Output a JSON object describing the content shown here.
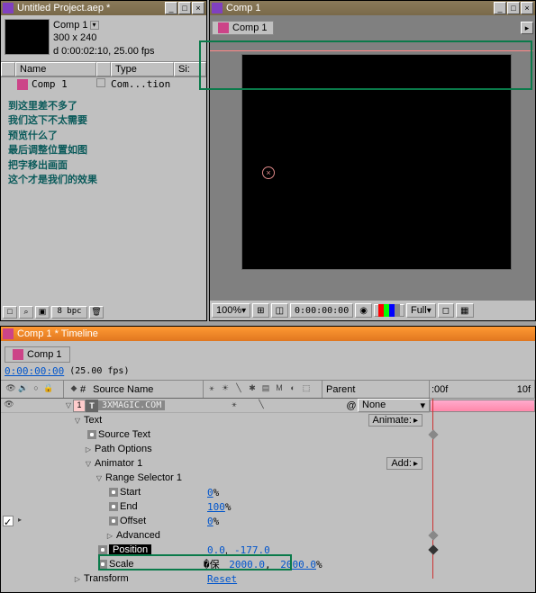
{
  "project": {
    "title": "Untitled Project.aep *",
    "comp_name": "Comp 1",
    "dims": "300 x 240",
    "duration": "d 0:00:02:10, 25.00 fps",
    "col_name": "Name",
    "col_type": "Type",
    "col_size": "Si:",
    "item_name": "Comp 1",
    "item_type": "Com...tion",
    "bpc": "8 bpc"
  },
  "instructions": {
    "l1": "到这里差不多了",
    "l2": "我们这下不太需要",
    "l3": "预览什么了",
    "l4": "最后调整位置如图",
    "l5": "把字移出画面",
    "l6": "这个才是我们的效果"
  },
  "viewer": {
    "title": "Comp 1",
    "tab": "Comp 1",
    "zoom": "100%",
    "time": "0:00:00:00",
    "view": "Full"
  },
  "timeline": {
    "title": "Comp 1 * Timeline",
    "tab": "Comp 1",
    "timecode": "0:00:00:00",
    "fps": "(25.00 fps)",
    "col_idx": "#",
    "col_src": "Source Name",
    "col_parent": "Parent",
    "rule0": ":00f",
    "rule1": "10f",
    "layer_idx": "1",
    "layer_name": "3XMAGIC.COM",
    "parent_none": "None",
    "animate": "Animate:",
    "add": "Add:",
    "props": {
      "text": "Text",
      "source_text": "Source Text",
      "path_options": "Path Options",
      "animator1": "Animator 1",
      "range_selector": "Range Selector 1",
      "start": "Start",
      "start_v": "0",
      "end": "End",
      "end_v": "100",
      "offset": "Offset",
      "offset_v": "0",
      "advanced": "Advanced",
      "position": "Position",
      "position_x": "0.0",
      "position_y": "-177.0",
      "scale": "Scale",
      "scale_x": "2000.0",
      "scale_y": "2000.0",
      "transform": "Transform",
      "reset": "Reset",
      "pct": "%"
    }
  }
}
